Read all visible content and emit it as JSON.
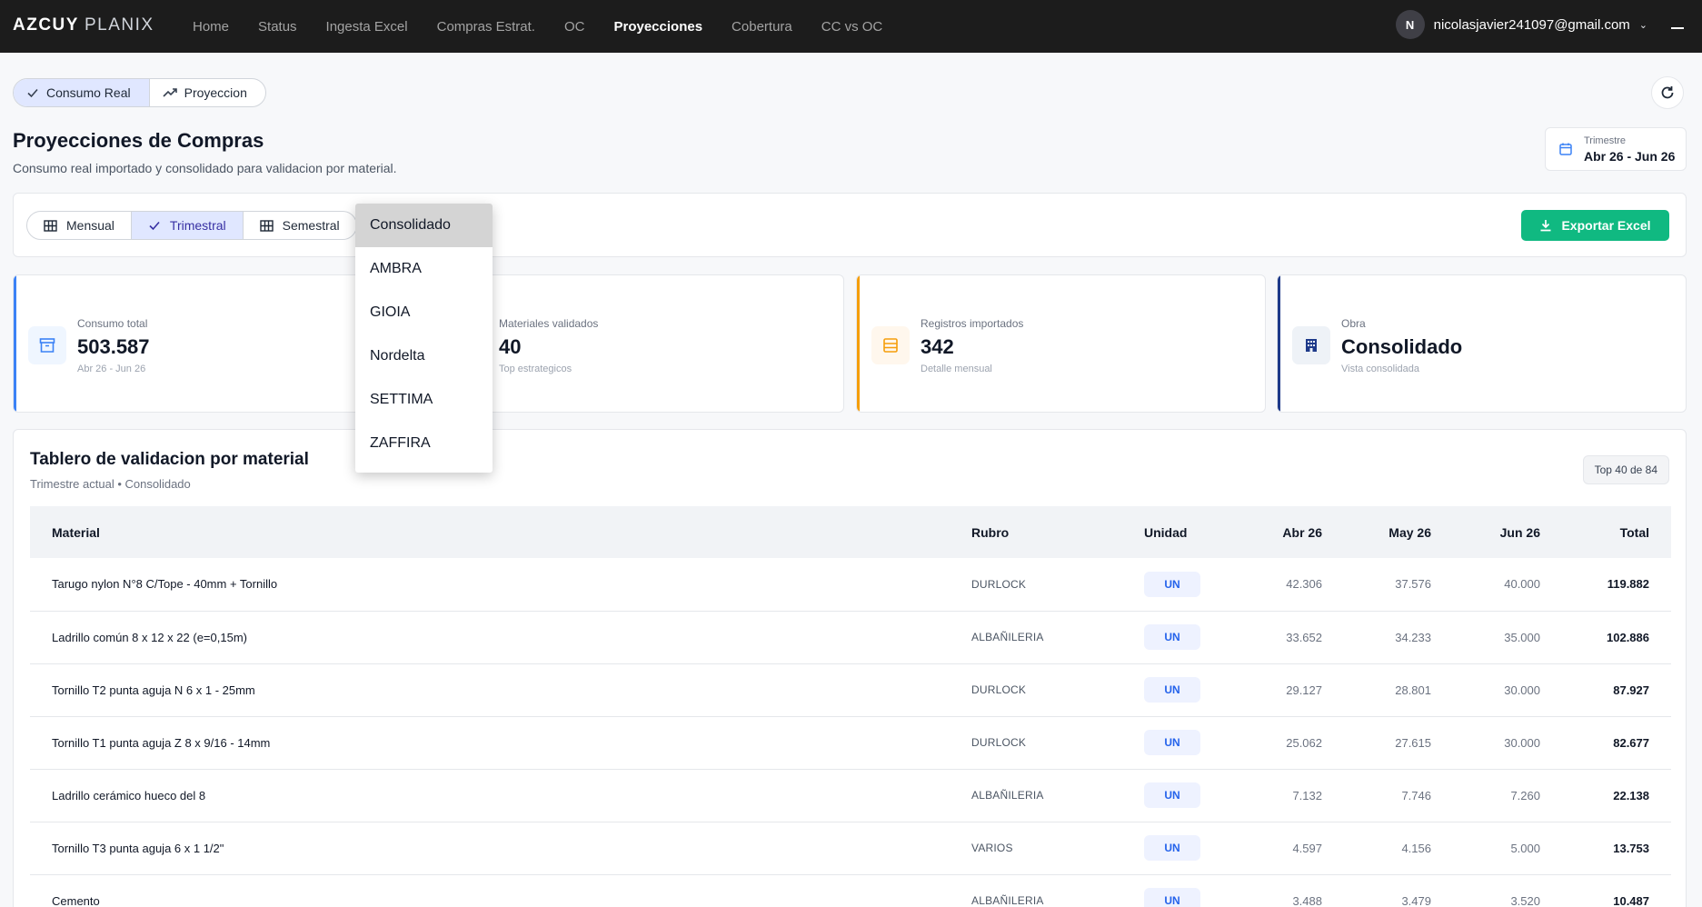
{
  "brand": {
    "bold": "AZCUY",
    "light": "PLANIX"
  },
  "nav": [
    {
      "label": "Home",
      "active": false
    },
    {
      "label": "Status",
      "active": false
    },
    {
      "label": "Ingesta Excel",
      "active": false
    },
    {
      "label": "Compras Estrat.",
      "active": false
    },
    {
      "label": "OC",
      "active": false
    },
    {
      "label": "Proyecciones",
      "active": true
    },
    {
      "label": "Cobertura",
      "active": false
    },
    {
      "label": "CC vs OC",
      "active": false
    }
  ],
  "user": {
    "initial": "N",
    "email": "nicolasjavier241097@gmail.com"
  },
  "mode_toggle": {
    "consumo": "Consumo Real",
    "proyeccion": "Proyeccion",
    "active": "consumo"
  },
  "page": {
    "title": "Proyecciones de Compras",
    "subtitle": "Consumo real importado y consolidado para validacion por material."
  },
  "period_box": {
    "label": "Trimestre",
    "value": "Abr 26 - Jun 26"
  },
  "period_group": {
    "mensual": "Mensual",
    "trimestral": "Trimestral",
    "semestral": "Semestral",
    "active": "trimestral"
  },
  "export_label": "Exportar Excel",
  "kpis": [
    {
      "label": "Consumo total",
      "value": "503.587",
      "sub": "Abr 26 - Jun 26",
      "color": "#3b82f6",
      "icon": "archive-icon"
    },
    {
      "label": "Materiales validados",
      "value": "40",
      "sub": "Top estrategicos",
      "color": "#22c55e",
      "icon": "check-icon"
    },
    {
      "label": "Registros importados",
      "value": "342",
      "sub": "Detalle mensual",
      "color": "#f59e0b",
      "icon": "list-icon"
    },
    {
      "label": "Obra",
      "value": "Consolidado",
      "sub": "Vista consolidada",
      "color": "#1e3a8a",
      "icon": "building-icon"
    }
  ],
  "table_card": {
    "title": "Tablero de validacion por material",
    "subtitle": "Trimestre actual • Consolidado",
    "count_badge": "Top 40 de 84",
    "headers": {
      "material": "Material",
      "rubro": "Rubro",
      "unidad": "Unidad",
      "m1": "Abr 26",
      "m2": "May 26",
      "m3": "Jun 26",
      "total": "Total"
    },
    "rows": [
      {
        "material": "Tarugo nylon N°8 C/Tope - 40mm + Tornillo",
        "rubro": "DURLOCK",
        "unidad": "UN",
        "m1": "42.306",
        "m2": "37.576",
        "m3": "40.000",
        "total": "119.882"
      },
      {
        "material": "Ladrillo común 8 x 12 x 22 (e=0,15m)",
        "rubro": "ALBAÑILERIA",
        "unidad": "UN",
        "m1": "33.652",
        "m2": "34.233",
        "m3": "35.000",
        "total": "102.886"
      },
      {
        "material": "Tornillo T2 punta aguja N 6 x 1 - 25mm",
        "rubro": "DURLOCK",
        "unidad": "UN",
        "m1": "29.127",
        "m2": "28.801",
        "m3": "30.000",
        "total": "87.927"
      },
      {
        "material": "Tornillo T1 punta aguja Z 8 x 9/16 - 14mm",
        "rubro": "DURLOCK",
        "unidad": "UN",
        "m1": "25.062",
        "m2": "27.615",
        "m3": "30.000",
        "total": "82.677"
      },
      {
        "material": "Ladrillo cerámico hueco del 8",
        "rubro": "ALBAÑILERIA",
        "unidad": "UN",
        "m1": "7.132",
        "m2": "7.746",
        "m3": "7.260",
        "total": "22.138"
      },
      {
        "material": "Tornillo T3 punta aguja 6 x 1 1/2\"",
        "rubro": "VARIOS",
        "unidad": "UN",
        "m1": "4.597",
        "m2": "4.156",
        "m3": "5.000",
        "total": "13.753"
      },
      {
        "material": "Cemento",
        "rubro": "ALBAÑILERIA",
        "unidad": "UN",
        "m1": "3.488",
        "m2": "3.479",
        "m3": "3.520",
        "total": "10.487"
      }
    ]
  },
  "obra_dropdown": {
    "options": [
      "Consolidado",
      "AMBRA",
      "GIOIA",
      "Nordelta",
      "SETTIMA",
      "ZAFFIRA"
    ],
    "selected": "Consolidado"
  }
}
